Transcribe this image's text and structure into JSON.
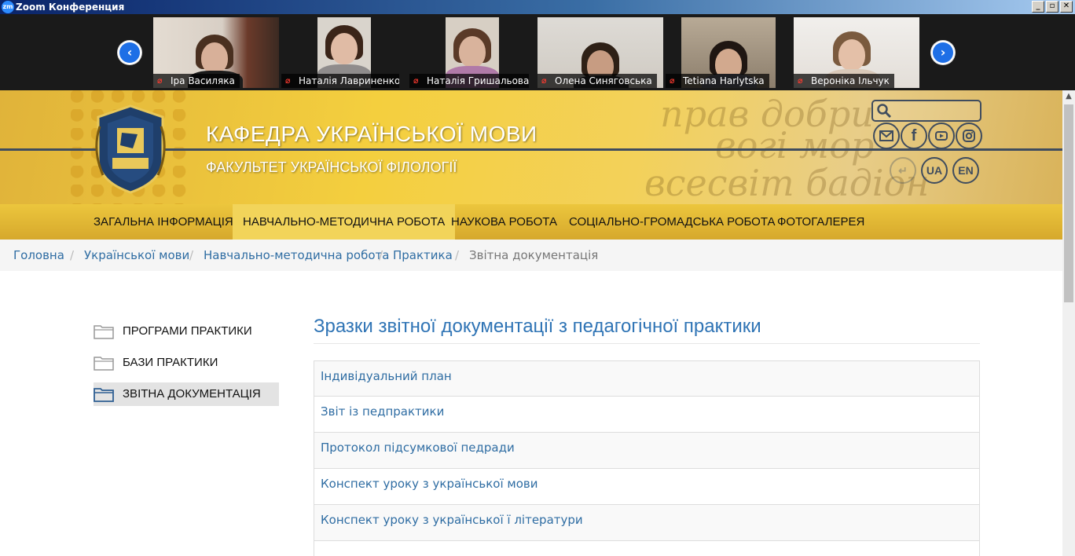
{
  "window": {
    "title": "Zoom Конференция",
    "logo": "zm"
  },
  "gallery": {
    "participants": [
      {
        "name": "Іра Василяка"
      },
      {
        "name": "Наталія Лавриненко"
      },
      {
        "name": "Наталія Гришальова"
      },
      {
        "name": "Олена Синяговська"
      },
      {
        "name": "Tetiana Harlytska"
      },
      {
        "name": "Вероніка Ільчук"
      }
    ]
  },
  "header": {
    "title": "КАФЕДРА УКРАЇНСЬКОЇ МОВИ",
    "subtitle": "ФАКУЛЬТЕТ УКРАЇНСЬКОЇ ФІЛОЛОГІЇ",
    "lang_ua": "UA",
    "lang_en": "EN"
  },
  "nav": {
    "items": [
      {
        "label": "ЗАГАЛЬНА ІНФОРМАЦІЯ"
      },
      {
        "label": "НАВЧАЛЬНО-МЕТОДИЧНА РОБОТА"
      },
      {
        "label": "НАУКОВА РОБОТА"
      },
      {
        "label": "СОЦІАЛЬНО-ГРОМАДСЬКА РОБОТА"
      },
      {
        "label": "ФОТОГАЛЕРЕЯ"
      }
    ]
  },
  "breadcrumb": {
    "items": [
      {
        "label": "Головна"
      },
      {
        "label": "Української мови"
      },
      {
        "label": "Навчально-методична робота"
      },
      {
        "label": "Практика"
      },
      {
        "label": "Звітна документація"
      }
    ]
  },
  "sidebar": {
    "items": [
      {
        "label": "ПРОГРАМИ ПРАКТИКИ"
      },
      {
        "label": "БАЗИ ПРАКТИКИ"
      },
      {
        "label": "ЗВІТНА ДОКУМЕНТАЦІЯ"
      }
    ]
  },
  "main": {
    "title": "Зразки звітної документації з педагогічної практики",
    "documents": [
      {
        "label": "Індивідуальний план"
      },
      {
        "label": "Звіт із педпрактики"
      },
      {
        "label": "Протокол підсумкової педради"
      },
      {
        "label": "Конспект уроку з української мови"
      },
      {
        "label": "Конспект уроку з української ї літератури"
      }
    ]
  },
  "colors": {
    "accent": "#2f74b5",
    "link": "#2f6da3",
    "banner": "#f4cf3e",
    "nav": "#e0b535"
  }
}
